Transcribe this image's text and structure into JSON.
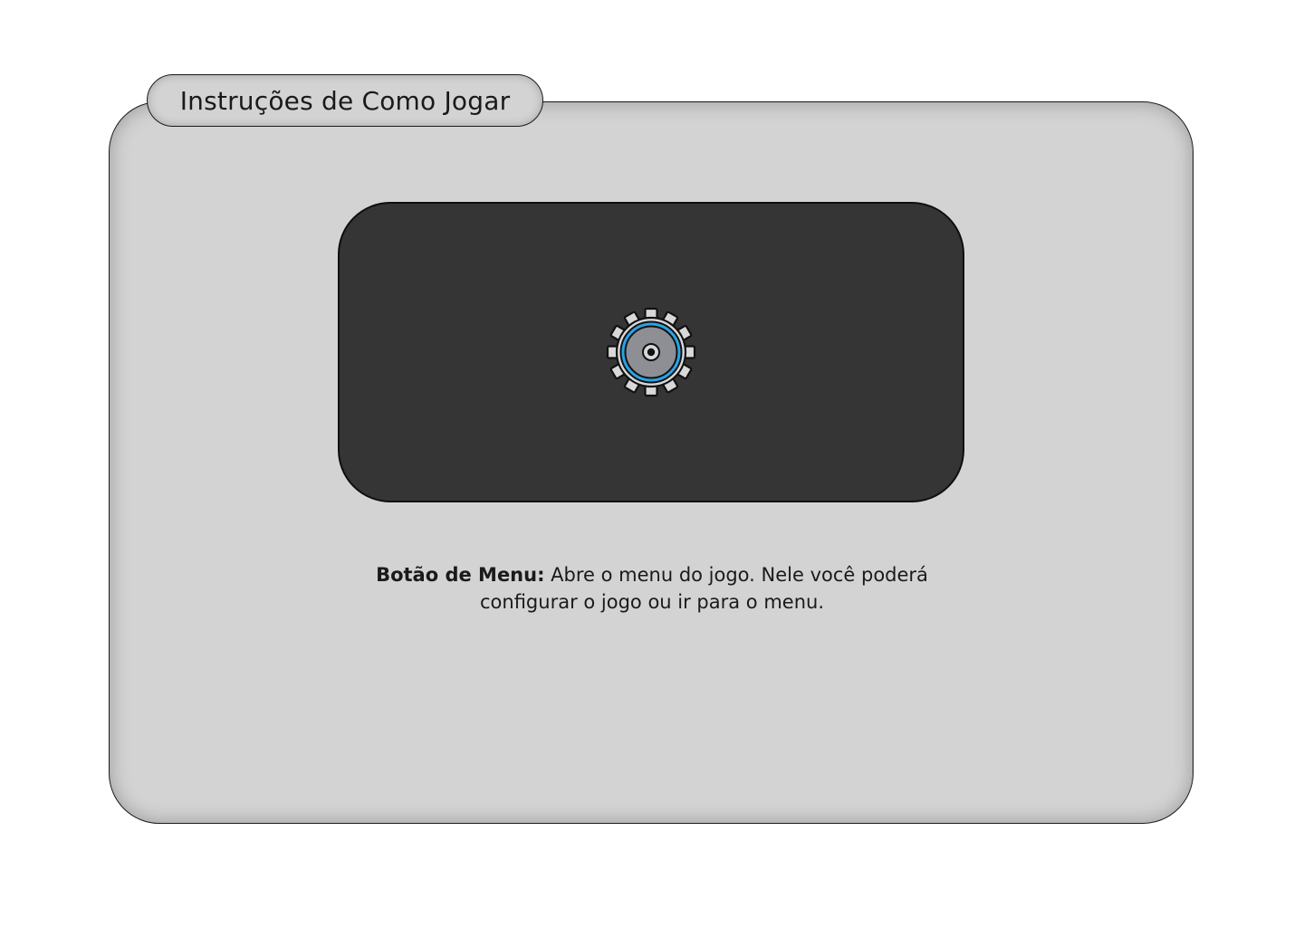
{
  "header": {
    "title": "Instruções de Como Jogar"
  },
  "preview": {
    "icon": "gear-icon"
  },
  "instruction": {
    "label": "Botão de Menu:",
    "text": " Abre o menu do jogo. Nele você poderá configurar o jogo ou ir para o menu."
  },
  "colors": {
    "panel": "#d3d3d3",
    "preview_bg": "#353535",
    "gear_body": "#d8d8d8",
    "gear_inner": "#8e8e95",
    "gear_ring": "#2aa3e6"
  }
}
